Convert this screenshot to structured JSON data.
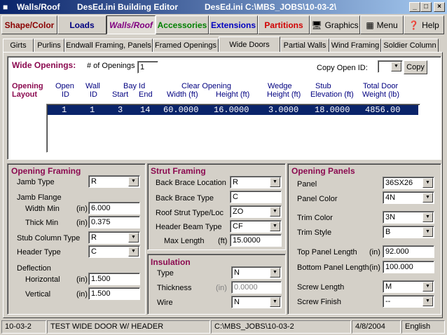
{
  "window": {
    "app": "Walls/Roof",
    "file": "DesEd.ini  Building Editor",
    "path": "DesEd.ini C:\\MBS_JOBS\\10-03-2\\",
    "min_icon": "minimize-icon",
    "max_icon": "maximize-icon",
    "close_icon": "close-icon"
  },
  "menu": {
    "shape_color": "Shape/Color",
    "loads": "Loads",
    "walls_roof": "Walls/Roof",
    "accessories": "Accessories",
    "extensions": "Extensions",
    "partitions": "Partitions",
    "graphics": "Graphics",
    "menu": "Menu",
    "help": "Help",
    "colors": {
      "shape": "#8b0000",
      "loads": "#000080",
      "walls": "#800080",
      "accessories": "#008000",
      "extensions": "#0000c0",
      "partitions": "#d00000"
    }
  },
  "tabs": [
    "Girts",
    "Purlins",
    "Endwall Framing, Panels",
    "Framed Openings",
    "Wide Doors",
    "Partial Walls",
    "Wind Framing",
    "Soldier Column"
  ],
  "selected_tab": "Wide Doors",
  "wide": {
    "title": "Wide Openings:",
    "num_label": "# of Openings",
    "num_value": "1",
    "copy_label": "Copy Open ID:",
    "copy_value": "",
    "copy_button": "Copy",
    "layout_label1": "Opening",
    "layout_label2": "Layout",
    "columns": {
      "open1": "Open",
      "open2": "ID",
      "wall1": "Wall",
      "wall2": "ID",
      "bay1": "Bay Id",
      "start": "Start",
      "end": "End",
      "clear": "Clear Opening",
      "width": "Width (ft)",
      "height": "Height (ft)",
      "wedge1": "Wedge",
      "wedge2": "Height (ft)",
      "stub1": "Stub",
      "stub2": "Elevation (ft)",
      "total1": "Total Door",
      "total2": "Weight  (lb)"
    },
    "rows": [
      {
        "open": "1",
        "wall": "1",
        "start": "3",
        "end": "14",
        "width": "60.0000",
        "height": "16.0000",
        "wedge": "3.0000",
        "stub": "18.0000",
        "weight": "4856.00"
      }
    ]
  },
  "framing": {
    "title": "Opening Framing",
    "jamb_type_label": "Jamb Type",
    "jamb_type": "R",
    "jamb_flange_label": "Jamb Flange",
    "width_min_label": "Width Min",
    "width_min": "6.000",
    "thick_min_label": "Thick Min",
    "thick_min": "0.375",
    "unit_in": "(in)",
    "stub_col_label": "Stub Column Type",
    "stub_col": "R",
    "header_label": "Header Type",
    "header": "C",
    "deflection_label": "Deflection",
    "horizontal_label": "Horizontal",
    "horizontal": "1.500",
    "vertical_label": "Vertical",
    "vertical": "1.500"
  },
  "strut": {
    "title": "Strut Framing",
    "bb_loc_label": "Back Brace Location",
    "bb_loc": "R",
    "bb_type_label": "Back Brace Type",
    "bb_type": "C",
    "roof_strut_label": "Roof Strut Type/Loc",
    "roof_strut": "ZO",
    "header_beam_label": "Header Beam Type",
    "header_beam": "CF",
    "max_len_label": "Max Length",
    "unit_ft": "(ft)",
    "max_len": "15.0000"
  },
  "insulation": {
    "title": "Insulation",
    "type_label": "Type",
    "type": "N",
    "thickness_label": "Thickness",
    "unit_in": "(in)",
    "thickness": "0.0000",
    "wire_label": "Wire",
    "wire": "N"
  },
  "panels": {
    "title": "Opening Panels",
    "panel_label": "Panel",
    "panel": "36SX26",
    "panel_color_label": "Panel Color",
    "panel_color": "4N",
    "trim_color_label": "Trim Color",
    "trim_color": "3N",
    "trim_style_label": "Trim Style",
    "trim_style": "B",
    "top_len_label": "Top Panel Length",
    "unit_in": "(in)",
    "top_len": "92.000",
    "bottom_len_label": "Bottom Panel Length",
    "bottom_len": "100.000",
    "screw_len_label": "Screw Length",
    "screw_len": "M",
    "screw_finish_label": "Screw Finish",
    "screw_finish": "--"
  },
  "status": {
    "job": "10-03-2",
    "desc": "TEST WIDE DOOR W/ HEADER",
    "path": "C:\\MBS_JOBS\\10-03-2",
    "date": "4/8/2004",
    "lang": "English"
  }
}
